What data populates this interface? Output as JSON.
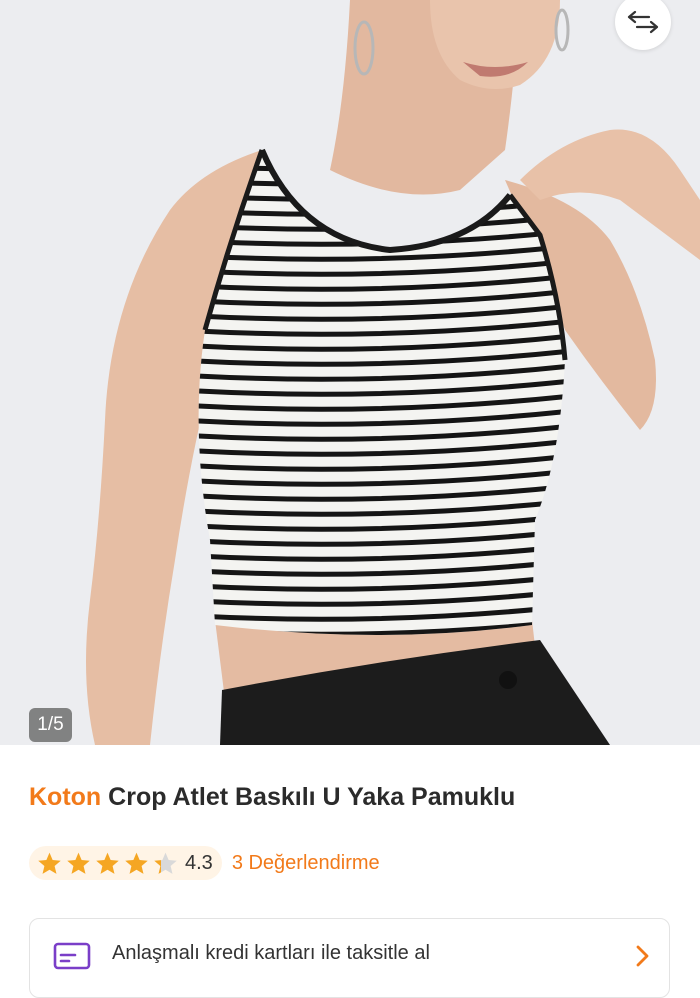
{
  "gallery": {
    "counter": "1/5",
    "share_icon": "swap-arrows-icon"
  },
  "product": {
    "brand": "Koton",
    "name": "Crop Atlet Baskılı U Yaka Pamuklu"
  },
  "rating": {
    "value": "4.3",
    "stars_filled": 4.3,
    "stars_total": 5,
    "review_label": "3 Değerlendirme",
    "star_color": "#f5a623"
  },
  "installment": {
    "label": "Anlaşmalı kredi kartları ile taksitle al",
    "icon": "credit-card-icon",
    "chevron": "chevron-right-icon"
  },
  "colors": {
    "accent": "#f27a1a",
    "icon_purple": "#7a3ec8"
  }
}
